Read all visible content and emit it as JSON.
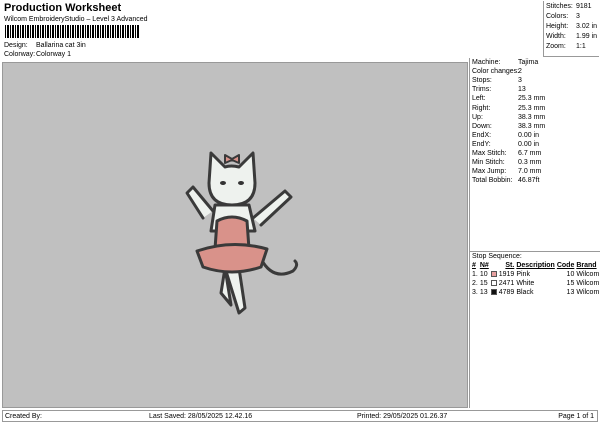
{
  "header": {
    "title": "Production Worksheet",
    "subtitle": "Wilcom EmbroideryStudio – Level 3 Advanced",
    "design_label": "Design:",
    "design_value": "Ballarina cat 3in",
    "colorway_label": "Colorway:",
    "colorway_value": "Colorway 1"
  },
  "stats": [
    {
      "label": "Stitches:",
      "value": "9181"
    },
    {
      "label": "Colors:",
      "value": "3"
    },
    {
      "label": "Height:",
      "value": "3.02 in"
    },
    {
      "label": "Width:",
      "value": "1.99 in"
    },
    {
      "label": "Zoom:",
      "value": "1:1"
    }
  ],
  "details": [
    {
      "label": "Machine:",
      "value": "Tajima"
    },
    {
      "label": "Color changes:",
      "value": "2"
    },
    {
      "label": "Stops:",
      "value": "3"
    },
    {
      "label": "Trims:",
      "value": "13"
    },
    {
      "label": "Left:",
      "value": "25.3 mm"
    },
    {
      "label": "Right:",
      "value": "25.3 mm"
    },
    {
      "label": "Up:",
      "value": "38.3 mm"
    },
    {
      "label": "Down:",
      "value": "38.3 mm"
    },
    {
      "label": "EndX:",
      "value": "0.00 in"
    },
    {
      "label": "EndY:",
      "value": "0.00 in"
    },
    {
      "label": "Max Stitch:",
      "value": "6.7 mm"
    },
    {
      "label": "Min Stitch:",
      "value": "0.3 mm"
    },
    {
      "label": "Max Jump:",
      "value": "7.0 mm"
    },
    {
      "label": "Total Bobbin:",
      "value": "46.87ft"
    }
  ],
  "stop_sequence": {
    "title": "Stop Sequence:",
    "headers": [
      "#",
      "N#",
      "St.",
      "Description",
      "Code",
      "Brand"
    ],
    "rows": [
      {
        "num": "1.",
        "n": "10",
        "color": "#e8a0a0",
        "st": "1919",
        "desc": "Pink",
        "code": "10",
        "brand": "Wilcom"
      },
      {
        "num": "2.",
        "n": "15",
        "color": "#ffffff",
        "st": "2471",
        "desc": "White",
        "code": "15",
        "brand": "Wilcom"
      },
      {
        "num": "3.",
        "n": "13",
        "color": "#111111",
        "st": "4789",
        "desc": "Black",
        "code": "13",
        "brand": "Wilcom"
      }
    ]
  },
  "footer": {
    "created_by": "Created By:",
    "last_saved": "Last Saved: 28/05/2025 12.42.16",
    "printed": "Printed: 29/05/2025 01.26.37",
    "page": "Page 1 of 1"
  }
}
